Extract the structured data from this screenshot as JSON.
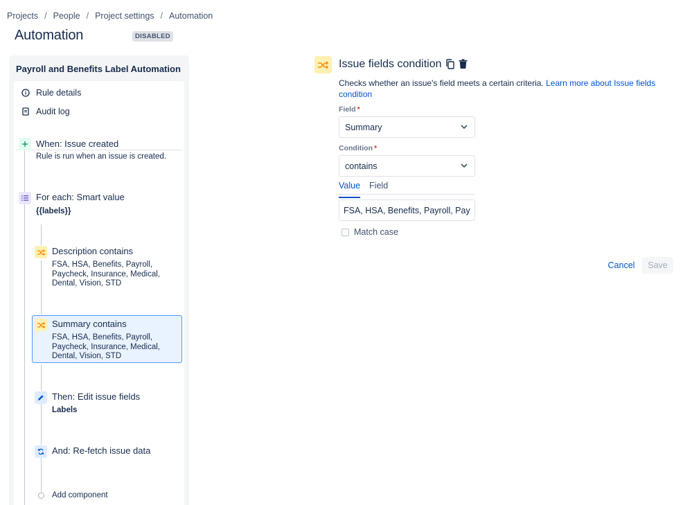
{
  "breadcrumb": {
    "items": [
      "Projects",
      "People",
      "Project settings",
      "Automation"
    ],
    "separator": "/"
  },
  "page": {
    "title": "Automation",
    "status": "DISABLED"
  },
  "rule": {
    "name": "Payroll and Benefits Label Automation",
    "menu": {
      "details": "Rule details",
      "audit": "Audit log"
    },
    "steps": {
      "trigger": {
        "title": "When: Issue created",
        "description": "Rule is run when an issue is created.",
        "icon": "plus-icon"
      },
      "branch": {
        "title": "For each: Smart value",
        "value": "{{labels}}",
        "icon": "list-icon"
      },
      "condition1": {
        "title": "Description contains",
        "description": "FSA, HSA, Benefits, Payroll, Paycheck, Insurance, Medical, Dental, Vision, STD",
        "icon": "shuffle-icon"
      },
      "condition2": {
        "title": "Summary contains",
        "description": "FSA, HSA, Benefits, Payroll, Paycheck, Insurance, Medical, Dental, Vision, STD",
        "icon": "shuffle-icon",
        "selected": true
      },
      "action1": {
        "title": "Then: Edit issue fields",
        "value": "Labels",
        "icon": "pencil-icon"
      },
      "action2": {
        "title": "And: Re-fetch issue data",
        "icon": "refresh-icon"
      }
    },
    "add_component": "Add component"
  },
  "condition_panel": {
    "title": "Issue fields condition",
    "description": "Checks whether an issue's field meets a certain criteria.",
    "learn_more": "Learn more about Issue fields condition",
    "field_label": "Field",
    "field_value": "Summary",
    "condition_label": "Condition",
    "condition_value": "contains",
    "tabs": [
      "Value",
      "Field"
    ],
    "active_tab": "Value",
    "value_input": "FSA, HSA, Benefits, Payroll, Paycheck, Insurance, Medical, Dental, Vision, STD",
    "match_case_label": "Match case",
    "match_case_checked": false,
    "required_marker": "*",
    "cancel_label": "Cancel",
    "save_label": "Save"
  },
  "colors": {
    "accent": "#0052cc",
    "selected_border": "#4c9aff",
    "selected_bg": "#e9f2ff",
    "condition_icon_bg": "#fff0b3",
    "condition_icon_fg": "#ff8b00",
    "trigger_icon_bg": "#e3fcef",
    "trigger_icon_fg": "#00875a",
    "branch_icon_bg": "#eae6ff",
    "branch_icon_fg": "#6554c0",
    "action_icon_bg": "#deebff",
    "action_icon_fg": "#0052cc",
    "required": "#de350b"
  }
}
